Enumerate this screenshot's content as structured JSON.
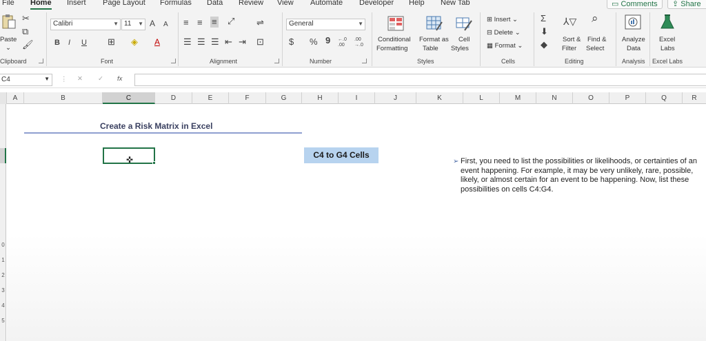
{
  "menu": {
    "tabs": [
      "File",
      "Home",
      "Insert",
      "Page Layout",
      "Formulas",
      "Data",
      "Review",
      "View",
      "Automate",
      "Developer",
      "Help",
      "New Tab"
    ],
    "active": "Home",
    "comments_label": "Comments",
    "share_label": "Share"
  },
  "ribbon": {
    "clipboard": {
      "paste_label": "Paste",
      "group_label": "Clipboard"
    },
    "font": {
      "name": "Calibri",
      "size": "11",
      "bold": "B",
      "italic": "I",
      "underline": "U",
      "grow": "A",
      "shrink": "A",
      "font_color": "A",
      "group_label": "Font"
    },
    "alignment": {
      "group_label": "Alignment"
    },
    "number": {
      "format": "General",
      "currency": "$",
      "percent": "%",
      "comma": "9",
      "inc_decimal": "←.0 .00",
      "dec_decimal": ".00 →.0",
      "group_label": "Number"
    },
    "styles": {
      "conditional_line1": "Conditional",
      "conditional_line2": "Formatting",
      "format_table_line1": "Format as",
      "format_table_line2": "Table",
      "cell_styles_line1": "Cell",
      "cell_styles_line2": "Styles",
      "group_label": "Styles"
    },
    "cells": {
      "insert": "Insert",
      "delete": "Delete",
      "format": "Format",
      "group_label": "Cells"
    },
    "editing": {
      "sort_line1": "Sort &",
      "sort_line2": "Filter",
      "find_line1": "Find &",
      "find_line2": "Select",
      "group_label": "Editing"
    },
    "analysis": {
      "line1": "Analyze",
      "line2": "Data",
      "group_label": "Analysis"
    },
    "excel_labs": {
      "line1": "Excel",
      "line2": "Labs",
      "group_label": "Excel Labs"
    }
  },
  "formula_bar": {
    "name_box": "C4",
    "fx": "fx",
    "cancel": "✕",
    "enter": "✓",
    "value": ""
  },
  "columns": [
    "A",
    "B",
    "C",
    "D",
    "E",
    "F",
    "G",
    "H",
    "I",
    "J",
    "K",
    "L",
    "M",
    "N",
    "O",
    "P",
    "Q",
    "R"
  ],
  "selected_column": "C",
  "rows_visible": [
    "0",
    "1",
    "2",
    "3",
    "4",
    "5"
  ],
  "sheet": {
    "title": "Create a Risk Matrix in Excel",
    "callout": "C4 to G4 Cells",
    "note": "First, you need to list the possibilities or likelihoods, or certainties of an event happening. For example, it may be very unlikely, rare, possible, likely, or almost certain for an event to be happening. Now, list these possibilities on cells C4:G4."
  },
  "colors": {
    "accent": "#217346",
    "callout_bg": "#b7d3ef",
    "title_underline": "#8e9fd0"
  }
}
